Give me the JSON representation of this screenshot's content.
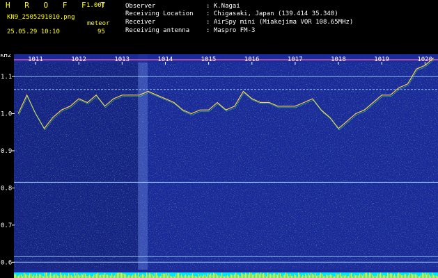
{
  "header": {
    "app_title": "H R O F F T",
    "version": "1.00f",
    "filename": "KN9_2505291010.png",
    "datetime": "25.05.29 10:10",
    "meteor_label": "meteor",
    "meteor_count": "95",
    "kHz_label": "kHz",
    "info": [
      {
        "key": "Observer",
        "value": ": K.Nagai"
      },
      {
        "key": "Receiving Location",
        "value": ": Chigasaki, Japan (139.414 35.340)"
      },
      {
        "key": "Receiver",
        "value": ": AirSpy mini (Miakejima VOR 108.65MHz)"
      },
      {
        "key": "Receiving antenna",
        "value": ": Maspro FM-3"
      }
    ]
  },
  "colors": {
    "background": "#1a2a9a",
    "trace": "#ffd24a",
    "lines": "#88c8ff",
    "header_text": "#ffff00"
  },
  "chart_data": {
    "type": "heatmap",
    "x_tick_labels": [
      "1011",
      "1012",
      "1013",
      "1014",
      "1015",
      "1016",
      "1017",
      "1018",
      "1019",
      "1020"
    ],
    "y_tick_labels": [
      "1.1",
      "1.0",
      "0.9",
      "0.8",
      "0.7",
      "0.6"
    ],
    "y_tick_values": [
      1.1,
      1.0,
      0.9,
      0.8,
      0.7,
      0.6
    ],
    "ylabel": "kHz",
    "ylim": [
      0.58,
      1.16
    ],
    "xlim": [
      1010.5,
      1020.3
    ],
    "trace": {
      "x": [
        1010.6,
        1010.8,
        1011.0,
        1011.2,
        1011.4,
        1011.6,
        1011.8,
        1012.0,
        1012.2,
        1012.4,
        1012.6,
        1012.8,
        1013.0,
        1013.2,
        1013.4,
        1013.6,
        1013.8,
        1014.0,
        1014.2,
        1014.4,
        1014.6,
        1014.8,
        1015.0,
        1015.2,
        1015.4,
        1015.6,
        1015.8,
        1016.0,
        1016.2,
        1016.4,
        1016.6,
        1016.8,
        1017.0,
        1017.2,
        1017.4,
        1017.6,
        1017.8,
        1018.0,
        1018.2,
        1018.4,
        1018.6,
        1018.8,
        1019.0,
        1019.2,
        1019.4,
        1019.6,
        1019.8,
        1020.0,
        1020.2
      ],
      "y": [
        1.0,
        1.05,
        1.0,
        0.96,
        0.99,
        1.01,
        1.02,
        1.04,
        1.03,
        1.05,
        1.02,
        1.04,
        1.05,
        1.05,
        1.05,
        1.06,
        1.05,
        1.04,
        1.03,
        1.01,
        1.0,
        1.01,
        1.01,
        1.03,
        1.01,
        1.02,
        1.06,
        1.04,
        1.03,
        1.03,
        1.02,
        1.02,
        1.02,
        1.03,
        1.04,
        1.01,
        0.99,
        0.96,
        0.98,
        1.0,
        1.01,
        1.03,
        1.05,
        1.05,
        1.07,
        1.08,
        1.12,
        1.13,
        1.15
      ]
    },
    "horizontal_lines_y": [
      1.145,
      1.1,
      1.065,
      0.815,
      0.615,
      0.6
    ]
  }
}
